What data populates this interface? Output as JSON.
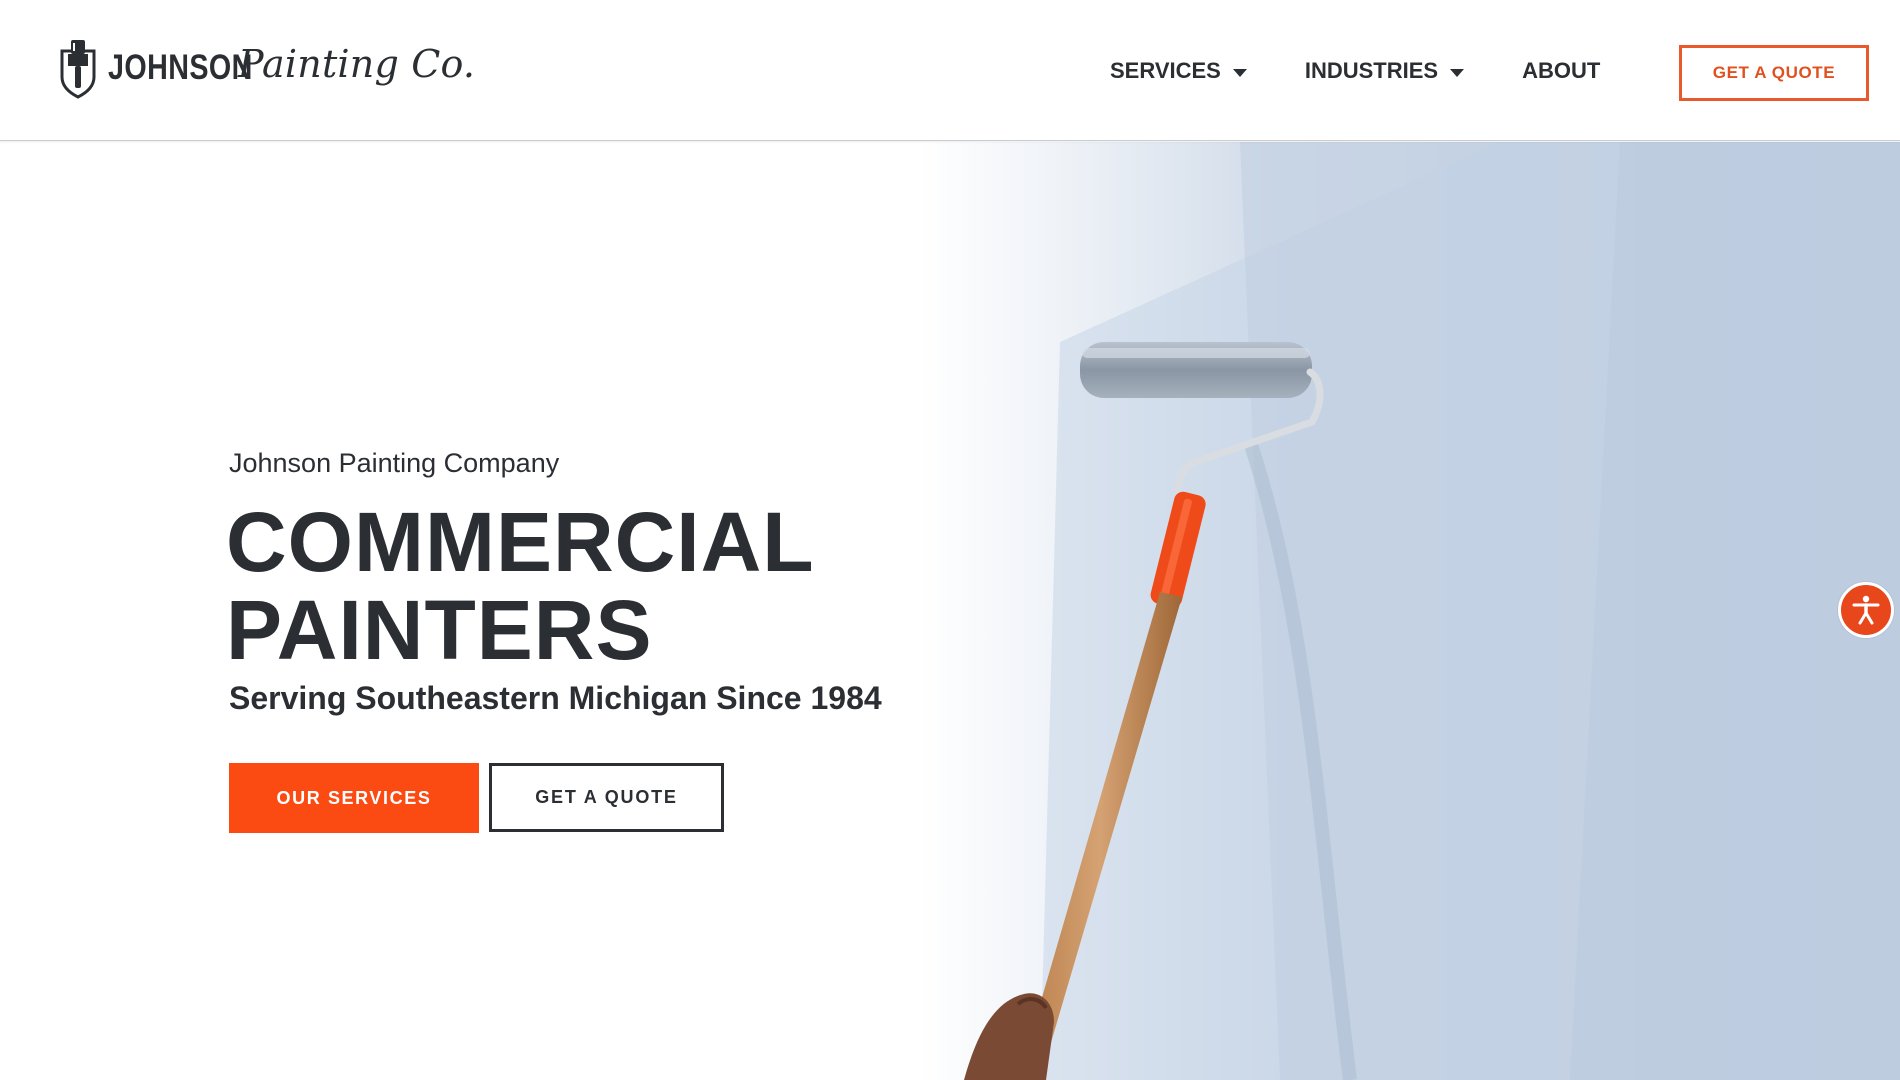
{
  "header": {
    "logo": {
      "wordmark": "JOHNSON",
      "script": "Painting Co."
    },
    "nav": [
      {
        "label": "SERVICES",
        "has_dropdown": true
      },
      {
        "label": "INDUSTRIES",
        "has_dropdown": true
      },
      {
        "label": "ABOUT",
        "has_dropdown": false
      }
    ],
    "cta_label": "GET A QUOTE"
  },
  "hero": {
    "eyebrow": "Johnson Painting Company",
    "headline_line1": "COMMERCIAL",
    "headline_line2": "PAINTERS",
    "subline": "Serving Southeastern Michigan Since 1984",
    "primary_button": "OUR SERVICES",
    "secondary_button": "GET A QUOTE",
    "image_icon": "paint-roller-photo"
  },
  "accessibility": {
    "icon": "accessibility-person-icon"
  },
  "colors": {
    "accent": "#fb4b13",
    "accent_outline": "#e85a2b",
    "text": "#2b2f33",
    "wall": "#c4d2e4"
  }
}
